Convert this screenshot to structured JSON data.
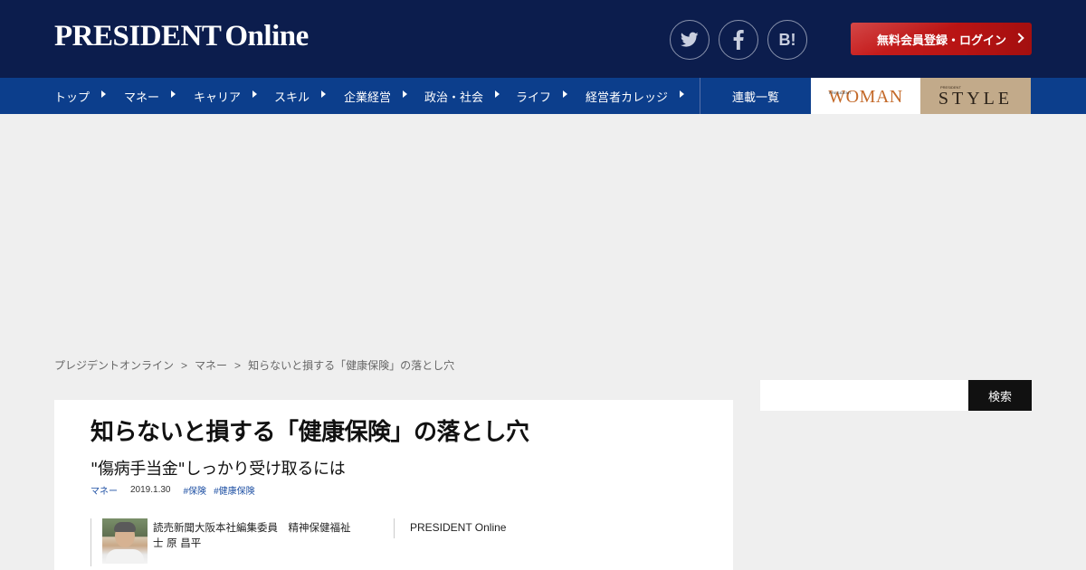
{
  "header": {
    "logo_main": "PRESIDENT",
    "logo_sub": "Online",
    "social": [
      {
        "icon": "twitter-icon"
      },
      {
        "icon": "facebook-icon"
      },
      {
        "label": "B!",
        "icon": "hatena-bookmark-icon"
      }
    ],
    "login_label": "無料会員登録・ログイン"
  },
  "nav": {
    "items": [
      {
        "label": "トップ"
      },
      {
        "label": "マネー"
      },
      {
        "label": "キャリア"
      },
      {
        "label": "スキル"
      },
      {
        "label": "企業経営"
      },
      {
        "label": "政治・社会"
      },
      {
        "label": "ライフ"
      },
      {
        "label": "経営者カレッジ"
      }
    ],
    "serial_label": "連載一覧",
    "woman": {
      "small": "PRESIDENT",
      "label": "WOMAN"
    },
    "style": {
      "small": "PRESIDENT",
      "label": "STYLE"
    }
  },
  "breadcrumb": {
    "items": [
      "プレジデントオンライン",
      "マネー",
      "知らないと損する「健康保険」の落とし穴"
    ],
    "separator": ">"
  },
  "article": {
    "title": "知らないと損する「健康保険」の落とし穴",
    "subtitle": "\"傷病手当金\"しっかり受け取るには",
    "category": "マネー",
    "date": "2019.1.30",
    "tags": [
      "#保険",
      "#健康保険"
    ],
    "author": {
      "line1": "読売新聞大阪本社編集委員　精神保健福祉",
      "line2": "士 原 昌平"
    },
    "publisher": "PRESIDENT Online"
  },
  "search": {
    "placeholder": "",
    "button_label": "検索"
  },
  "colors": {
    "header_bg": "#0c1d4d",
    "nav_bg": "#0c3e8c",
    "login_bg": "#c91f1f",
    "link": "#1d4fa3"
  }
}
